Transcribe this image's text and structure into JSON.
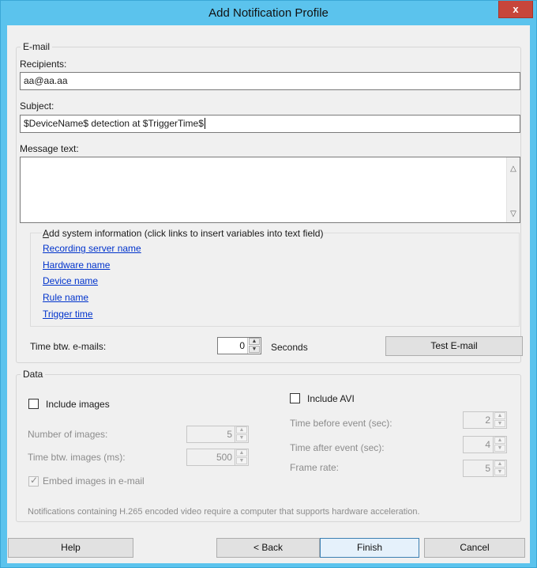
{
  "window": {
    "title": "Add Notification Profile",
    "close_glyph": "x"
  },
  "email": {
    "group_label": "E-mail",
    "recipients_label": "Recipients:",
    "recipients_value": "aa@aa.aa",
    "subject_label": "Subject:",
    "subject_value": "$DeviceName$ detection at $TriggerTime$",
    "message_label": "Message text:",
    "message_value": "",
    "sysinfo_title": "Add system information (click links to insert variables into text field)",
    "sysinfo_title_access_key": "A",
    "sysinfo_title_rest": "dd system information (click links to insert variables into text field)",
    "links": [
      "Recording server name",
      "Hardware name",
      "Device name",
      "Rule name",
      "Trigger time"
    ],
    "time_btw_label": "Time btw. e-mails:",
    "time_btw_value": "0",
    "time_btw_unit": "Seconds",
    "test_button": "Test E-mail"
  },
  "data": {
    "group_label": "Data",
    "include_images_label": "Include images",
    "include_images_checked": false,
    "num_images_label": "Number of images:",
    "num_images_value": "5",
    "time_btw_images_label": "Time btw. images (ms):",
    "time_btw_images_value": "500",
    "embed_label": "Embed images in e-mail",
    "embed_checked": true,
    "include_avi_label": "Include AVI",
    "include_avi_checked": false,
    "time_before_label": "Time before event (sec):",
    "time_before_value": "2",
    "time_after_label": "Time after event (sec):",
    "time_after_value": "4",
    "frame_rate_label": "Frame rate:",
    "frame_rate_value": "5"
  },
  "note": "Notifications containing H.265 encoded video require a computer that supports hardware acceleration.",
  "footer": {
    "help": "Help",
    "back": "< Back",
    "finish": "Finish",
    "cancel": "Cancel"
  },
  "colors": {
    "titlebar": "#5bc3ed",
    "close": "#c7463b",
    "link": "#0033cc",
    "client": "#f0f0f0"
  }
}
